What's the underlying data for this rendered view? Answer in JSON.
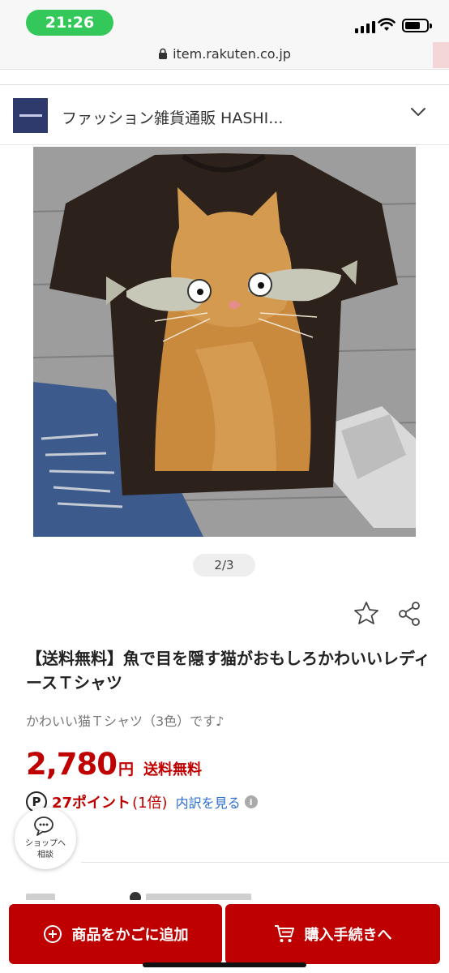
{
  "status": {
    "time": "21:26",
    "icons": [
      "cellular-signal-icon",
      "wifi-icon",
      "battery-icon"
    ]
  },
  "browser": {
    "url": "item.rakuten.co.jp",
    "lock_icon": "lock-icon"
  },
  "shop": {
    "name": "ファッション雑貨通販 HASHI...",
    "expand_icon": "chevron-down-icon"
  },
  "gallery": {
    "image_alt": "cat-holding-fish-tshirt-photo",
    "page_indicator": "2/3"
  },
  "actions": {
    "favorite_icon": "star-icon",
    "share_icon": "share-icon"
  },
  "product": {
    "title": "【送料無料】魚で目を隠す猫がおもしろかわいいレディースＴシャツ",
    "catch_copy": "かわいい猫Ｔシャツ（3色）です♪",
    "price": "2,780",
    "currency": "円",
    "shipping": "送料無料",
    "points": {
      "icon": "P",
      "amount": "27ポイント",
      "multiplier": "(1倍)",
      "breakdown_link": "内訳を見る",
      "info_icon": "i"
    }
  },
  "chat": {
    "label_line1": "ショップへ",
    "label_line2": "相談",
    "icon": "chat-bubble-icon"
  },
  "bottom": {
    "add_to_cart": "商品をかごに追加",
    "checkout": "購入手続きへ",
    "add_icon": "plus-circle-icon",
    "cart_icon": "cart-icon"
  },
  "colors": {
    "accent": "#bf0000",
    "link": "#2b6cd1",
    "status_pill": "#34c759"
  }
}
